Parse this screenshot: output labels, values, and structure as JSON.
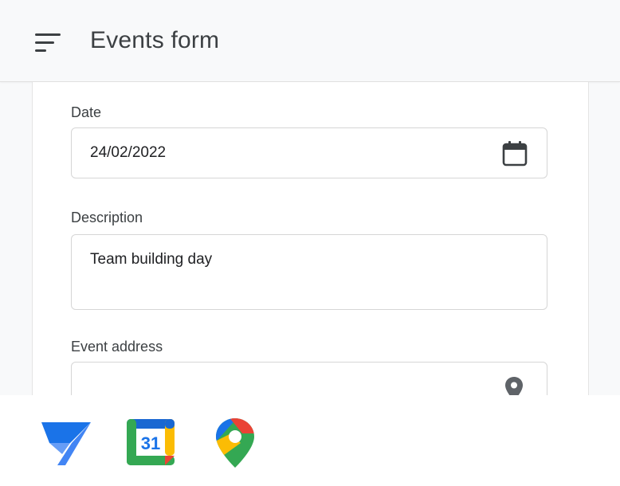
{
  "header": {
    "title": "Events form",
    "menu_icon": "menu-icon"
  },
  "form": {
    "date": {
      "label": "Date",
      "value": "24/02/2022",
      "icon": "calendar-icon"
    },
    "description": {
      "label": "Description",
      "value": "Team building day"
    },
    "address": {
      "label": "Event address",
      "value": "",
      "icon": "location-pin-icon"
    }
  },
  "apps": [
    {
      "name": "appsheet-logo-icon",
      "color": "#4285f4"
    },
    {
      "name": "google-calendar-logo-icon",
      "text": "31",
      "color": "#1a73e8"
    },
    {
      "name": "google-maps-logo-icon",
      "color": "#ea4335"
    }
  ],
  "colors": {
    "background": "#f8f9fa",
    "card": "#ffffff",
    "border": "#d6d6d6",
    "text": "#202124"
  }
}
